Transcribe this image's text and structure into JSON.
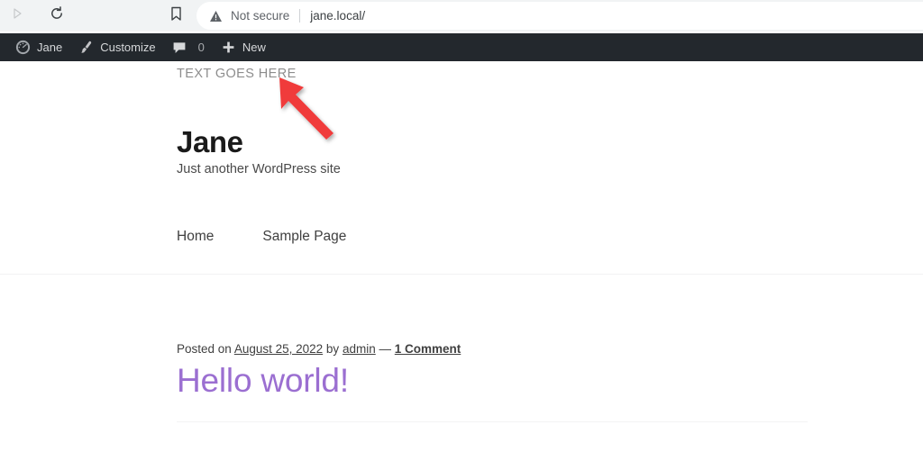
{
  "browser": {
    "forward_icon": "forward-arrow-icon",
    "reload_icon": "reload-icon",
    "bookmark_icon": "bookmark-icon",
    "security_icon": "not-secure-warning-icon",
    "security_label": "Not secure",
    "url": "jane.local/"
  },
  "adminbar": {
    "items": [
      {
        "icon": "wordpress-dashboard-icon",
        "label": "Jane"
      },
      {
        "icon": "paintbrush-icon",
        "label": "Customize"
      },
      {
        "icon": "comment-bubble-icon",
        "label": "",
        "count": "0"
      },
      {
        "icon": "plus-icon",
        "label": "New"
      }
    ]
  },
  "site": {
    "branding_text": "TEXT GOES HERE",
    "title": "Jane",
    "description": "Just another WordPress site",
    "nav": [
      {
        "label": "Home"
      },
      {
        "label": "Sample Page"
      }
    ]
  },
  "post": {
    "meta_posted_on": "Posted on",
    "meta_date": "August 25, 2022",
    "meta_by": "by",
    "meta_author": "admin",
    "meta_dash": "—",
    "meta_comments": "1 Comment",
    "title": "Hello world!"
  },
  "annotation": {
    "arrow_color": "#f03a3a",
    "name": "red-pointer-arrow"
  },
  "colors": {
    "adminbar_bg": "#23282d",
    "toolbar_bg": "#f1f3f4",
    "post_title": "#9b6fd1",
    "branding_text": "#8d8d8d"
  }
}
